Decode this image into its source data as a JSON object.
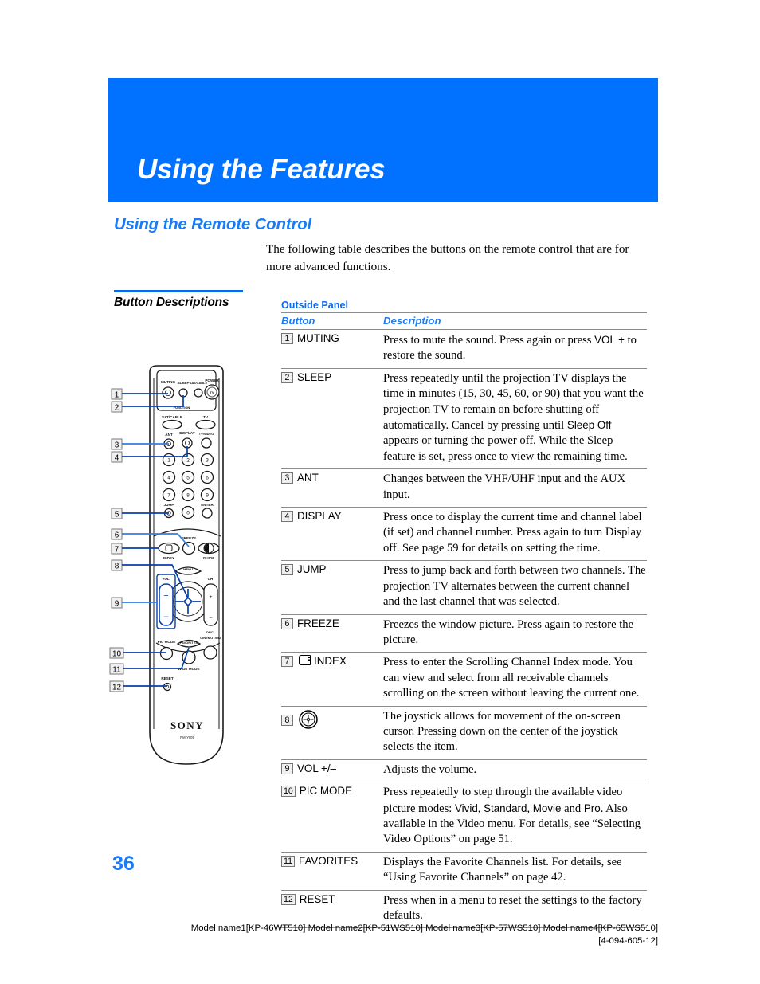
{
  "banner": {
    "title": "Using the Features",
    "color": "#0072ff"
  },
  "section": {
    "heading": "Using the Remote Control",
    "color": "#1a7cf5"
  },
  "intro": {
    "text": "The following table describes the buttons on the remote control that are for more advanced functions."
  },
  "left_column": {
    "heading": "Button Descriptions"
  },
  "table": {
    "caption": "Outside Panel",
    "headers": {
      "button": "Button",
      "description": "Description"
    },
    "rows": [
      {
        "num": "1",
        "icon": "",
        "button": "MUTING",
        "desc_html": "Press to mute the sound. Press again or press <span class=\"sans\">VOL +</span> to restore the sound."
      },
      {
        "num": "2",
        "icon": "",
        "button": "SLEEP",
        "desc_html": "Press repeatedly until the projection TV displays the time in minutes (15, 30, 45, 60, or 90) that you want the projection TV to remain on before shutting off automatically. Cancel by pressing until <span class=\"sans\">Sleep Off</span> appears or turning the power off. While the Sleep feature is set, press once to view the remaining time."
      },
      {
        "num": "3",
        "icon": "",
        "button": "ANT",
        "desc_html": "Changes between the VHF/UHF input and the AUX input."
      },
      {
        "num": "4",
        "icon": "",
        "button": "DISPLAY",
        "desc_html": "Press once to display the current time and channel label (if set) and channel number. Press again to turn Display off. See page 59 for details on setting the time."
      },
      {
        "num": "5",
        "icon": "",
        "button": "JUMP",
        "desc_html": "Press to jump back and forth between two channels. The projection TV alternates between the current channel and the last channel that was selected."
      },
      {
        "num": "6",
        "icon": "",
        "button": "FREEZE",
        "desc_html": "Freezes the window picture. Press again to restore the picture."
      },
      {
        "num": "7",
        "icon": "index-icon",
        "button": "INDEX",
        "desc_html": "Press to enter the Scrolling Channel Index mode. You can view and select from all receivable channels scrolling on the screen without leaving the current one."
      },
      {
        "num": "8",
        "icon": "joystick-icon",
        "button": "",
        "desc_html": "The joystick allows for movement of the on-screen cursor. Pressing down on the center of the joystick selects the item."
      },
      {
        "num": "9",
        "icon": "",
        "button": "VOL +/–",
        "desc_html": "Adjusts the volume."
      },
      {
        "num": "10",
        "icon": "",
        "button": "PIC MODE",
        "desc_html": "Press repeatedly to step through the available video picture modes: <span class=\"sans\">Vivid</span>, <span class=\"sans\">Standard</span>, <span class=\"sans\">Movie</span> and <span class=\"sans\">Pro</span>. Also available in the Video menu. For details, see “Selecting Video Options” on page 51."
      },
      {
        "num": "11",
        "icon": "",
        "button": "FAVORITES",
        "desc_html": "Displays the Favorite Channels list. For details, see “Using Favorite Channels” on page 42."
      },
      {
        "num": "12",
        "icon": "",
        "button": "RESET",
        "desc_html": "Press when in a menu to reset the settings to the factory defaults."
      }
    ]
  },
  "figure": {
    "brand": "SONY",
    "model": "RM-Y909",
    "callouts": [
      "1",
      "2",
      "3",
      "4",
      "5",
      "6",
      "7",
      "8",
      "9",
      "10",
      "11",
      "12"
    ],
    "labels": {
      "muting": "MUTING",
      "sleep": "SLEEP",
      "satcable_top": "SAT/CABLE",
      "power": "POWER",
      "power_tv": "TV",
      "function": "FUNCTION",
      "satcable": "SAT/CABLE",
      "tv": "TV",
      "ant": "ANT",
      "display": "DISPLAY",
      "tvvideo": "TV/VIDEO",
      "jump": "JUMP",
      "enter": "ENTER",
      "freeze": "FREEZE",
      "index": "INDEX",
      "guide": "GUIDE",
      "menu": "MENU",
      "vol": "VOL",
      "ch": "CH",
      "plus": "+",
      "minus": "–",
      "drc": "DRC/",
      "cinemotion": "CINEMOTION",
      "picmode": "PIC MODE",
      "favorites": "FAVORITES",
      "widemode": "WIDE MODE",
      "reset": "RESET"
    },
    "keypad": [
      "1",
      "2",
      "3",
      "4",
      "5",
      "6",
      "7",
      "8",
      "9",
      "0"
    ]
  },
  "page": {
    "number": "36"
  },
  "footer": {
    "line1": "Model name1[KP-46WT510] Model name2[KP-51WS510] Model name3[KP-57WS510] Model name4[KP-65WS510]",
    "line2": "[4-094-605-12]"
  }
}
